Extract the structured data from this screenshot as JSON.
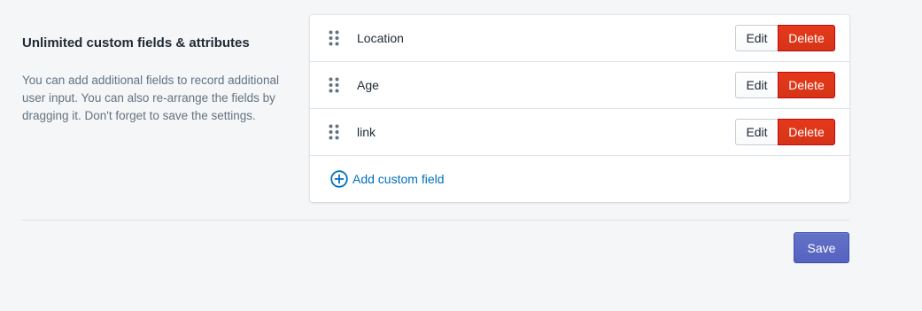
{
  "section": {
    "title": "Unlimited custom fields & attributes",
    "description": "You can add additional fields to record additional user input. You can also re-arrange the fields by dragging it. Don't forget to save the settings."
  },
  "fields": [
    {
      "label": "Location",
      "edit_label": "Edit",
      "delete_label": "Delete"
    },
    {
      "label": "Age",
      "edit_label": "Edit",
      "delete_label": "Delete"
    },
    {
      "label": "link",
      "edit_label": "Edit",
      "delete_label": "Delete"
    }
  ],
  "add_field": {
    "label": "Add custom field",
    "icon": "plus-circle-icon"
  },
  "footer": {
    "save_label": "Save"
  },
  "colors": {
    "delete": "#de3618",
    "save": "#5c6ac4",
    "link": "#006fbb"
  }
}
